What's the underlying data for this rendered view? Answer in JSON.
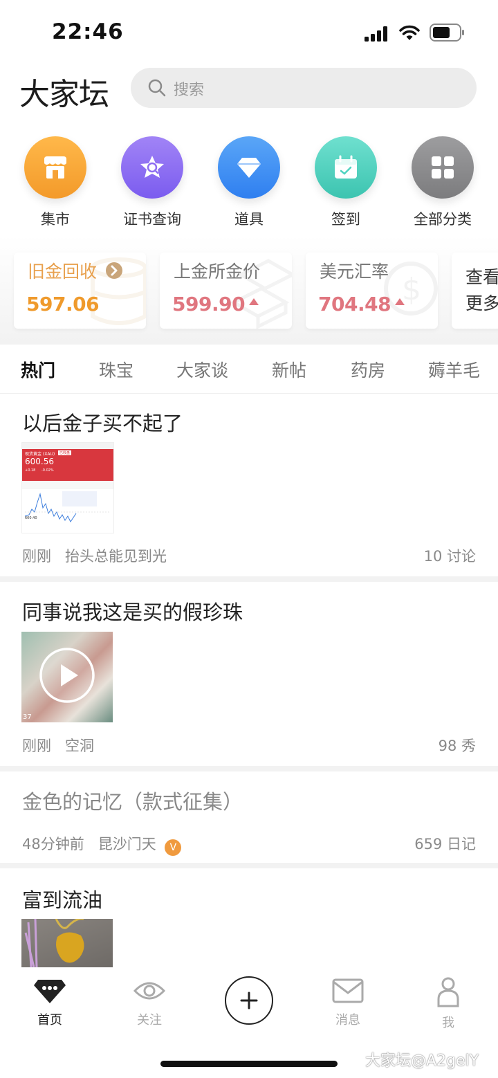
{
  "status_bar": {
    "time": "22:46"
  },
  "header": {
    "logo": "大家坛",
    "search_placeholder": "搜索"
  },
  "categories": [
    {
      "label": "集市",
      "icon": "shop-icon",
      "color": "#f6a236"
    },
    {
      "label": "证书查询",
      "icon": "certificate-search-icon",
      "color": "#8f6ef2"
    },
    {
      "label": "道具",
      "icon": "diamond-icon",
      "color": "#3b8df3"
    },
    {
      "label": "签到",
      "icon": "calendar-check-icon",
      "color": "#4fd3c0"
    },
    {
      "label": "全部分类",
      "icon": "grid-icon",
      "color": "#8d8d8f"
    }
  ],
  "price_cards": [
    {
      "title": "旧金回收",
      "value": "597.06",
      "title_color": "#e8a04d",
      "value_color": "#ef9a2c"
    },
    {
      "title": "上金所金价",
      "value": "599.90",
      "value_color": "#e0767f"
    },
    {
      "title": "美元汇率",
      "value": "704.48",
      "value_color": "#e0767f"
    }
  ],
  "more_card": {
    "line1": "查看",
    "line2": "更多"
  },
  "tabs": [
    "热门",
    "珠宝",
    "大家谈",
    "新帖",
    "药房",
    "薅羊毛"
  ],
  "posts": [
    {
      "title": "以后金子买不起了",
      "time": "刚刚",
      "author": "抬头总能见到光",
      "count": "10 讨论",
      "thumb": {
        "name": "现货黄金 (XAU)",
        "price": "600.56",
        "change": "+0.18",
        "pct": "-0.02%",
        "badge": "已收盘",
        "low": "600.40"
      }
    },
    {
      "title": "同事说我这是买的假珍珠",
      "time": "刚刚",
      "author": "空洞",
      "count": "98 秀",
      "thumb_note": "37"
    },
    {
      "title": "金色的记忆（款式征集）",
      "time": "48分钟前",
      "author": "昆沙门天",
      "badge": "V",
      "count": "659 日记"
    },
    {
      "title": "富到流油"
    }
  ],
  "bottom_nav": [
    {
      "label": "首页",
      "icon": "home-diamond-icon"
    },
    {
      "label": "关注",
      "icon": "eye-icon"
    },
    {
      "label": "消息",
      "icon": "mail-icon"
    },
    {
      "label": "我",
      "icon": "person-icon"
    }
  ],
  "watermark": "大家坛@A2gelY"
}
